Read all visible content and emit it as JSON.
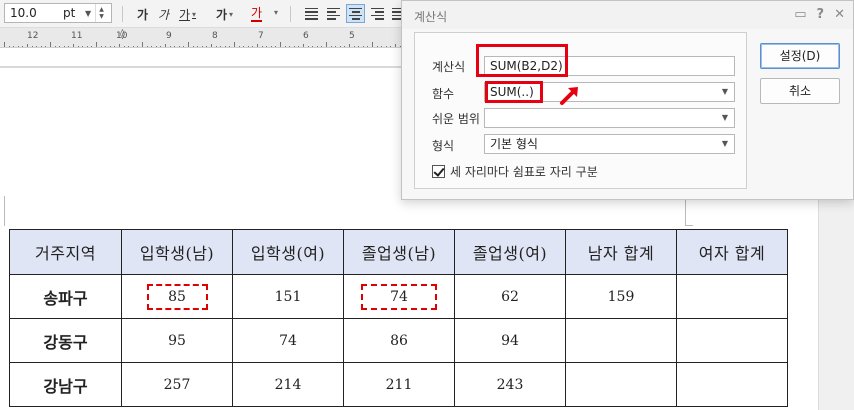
{
  "toolbar": {
    "font_size_value": "10.0",
    "font_size_unit": "pt",
    "bold_label": "가",
    "italic_label": "가",
    "underline_label": "가",
    "font_color_label": "가",
    "strike_label": "가"
  },
  "ruler": {
    "numbers": [
      "12",
      "11",
      "10",
      "9",
      "8",
      "7",
      "6",
      "5"
    ]
  },
  "dialog": {
    "title": "계산식",
    "formula_label": "계산식",
    "formula_value": "SUM(B2,D2)",
    "function_label": "함수",
    "function_value": "SUM(..)",
    "easy_range_label": "쉬운 범위",
    "easy_range_value": "",
    "format_label": "형식",
    "format_value": "기본 형식",
    "thousands_separator_label": "세 자리마다 쉼표로 자리 구분",
    "thousands_separator_checked": true,
    "ok_button": "설정(D)",
    "cancel_button": "취소",
    "highlight_color": "#e60012"
  },
  "table": {
    "headers": [
      "거주지역",
      "입학생(남)",
      "입학생(여)",
      "졸업생(남)",
      "졸업생(여)",
      "남자 합계",
      "여자 합계"
    ],
    "rows": [
      [
        "송파구",
        "85",
        "151",
        "74",
        "62",
        "159",
        ""
      ],
      [
        "강동구",
        "95",
        "74",
        "86",
        "94",
        "",
        ""
      ],
      [
        "강남구",
        "257",
        "214",
        "211",
        "243",
        "",
        ""
      ]
    ],
    "header_bg": "#dfe5f5"
  }
}
